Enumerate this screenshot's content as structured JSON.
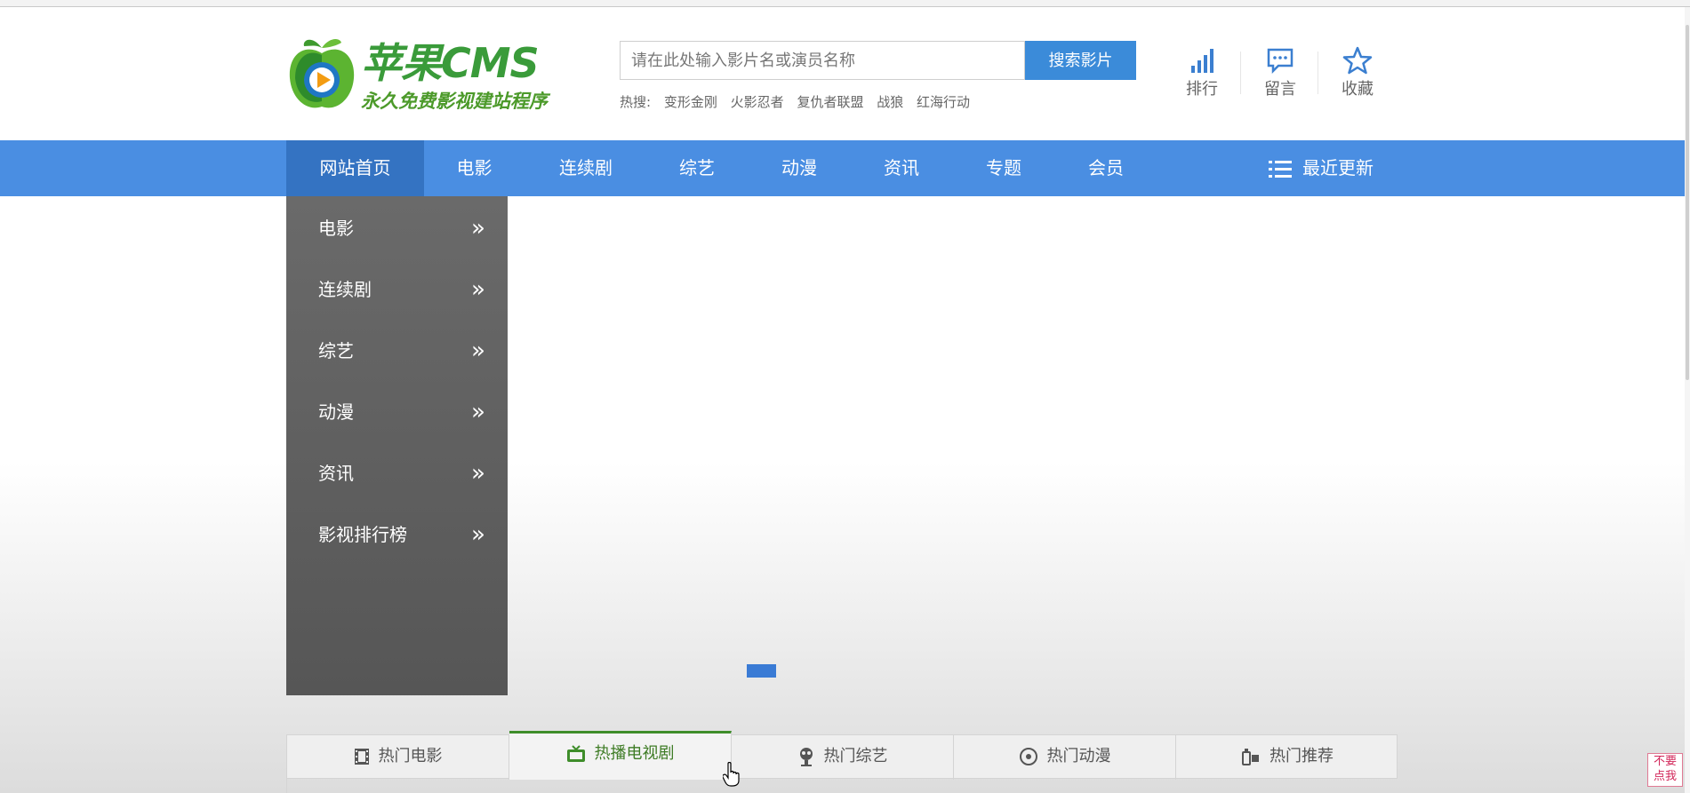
{
  "logo": {
    "title": "苹果CMS",
    "subtitle": "永久免费影视建站程序"
  },
  "search": {
    "placeholder": "请在此处输入影片名或演员名称",
    "button": "搜索影片"
  },
  "hot": {
    "label": "热搜:",
    "items": [
      "变形金刚",
      "火影忍者",
      "复仇者联盟",
      "战狼",
      "红海行动"
    ]
  },
  "quick": [
    {
      "label": "排行",
      "icon": "bar-chart-icon"
    },
    {
      "label": "留言",
      "icon": "message-icon"
    },
    {
      "label": "收藏",
      "icon": "star-icon"
    }
  ],
  "nav": {
    "items": [
      "网站首页",
      "电影",
      "连续剧",
      "综艺",
      "动漫",
      "资讯",
      "专题",
      "会员"
    ],
    "active": 0,
    "recent": "最近更新"
  },
  "side": {
    "items": [
      "电影",
      "连续剧",
      "综艺",
      "动漫",
      "资讯",
      "影视排行榜"
    ],
    "arrow": "»"
  },
  "tabs": {
    "items": [
      {
        "label": "热门电影",
        "icon": "film-icon"
      },
      {
        "label": "热播电视剧",
        "icon": "tv-icon"
      },
      {
        "label": "热门综艺",
        "icon": "mic-icon"
      },
      {
        "label": "热门动漫",
        "icon": "disc-icon"
      },
      {
        "label": "热门推荐",
        "icon": "recommend-icon"
      }
    ],
    "active": 1
  },
  "fixed": {
    "line1": "不要",
    "line2": "点我"
  },
  "colors": {
    "brand": "#4a8ee2",
    "active_nav": "#3473c2",
    "green": "#3e8d2a",
    "side": "#626262"
  }
}
